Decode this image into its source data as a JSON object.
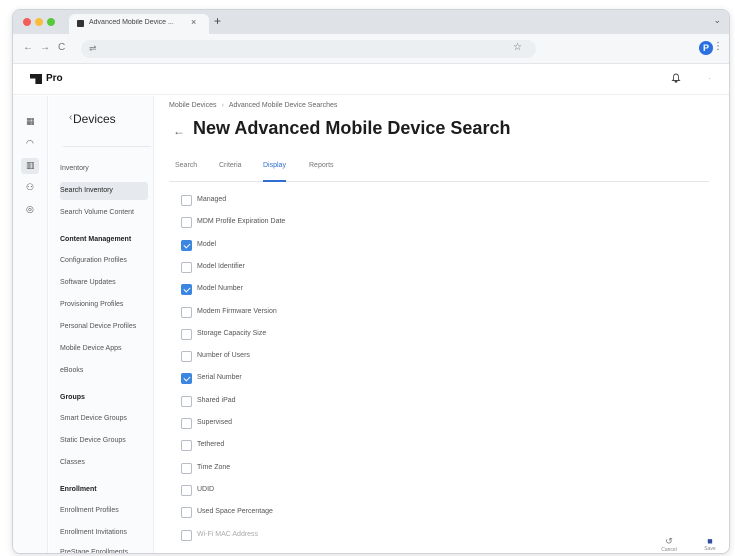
{
  "browser": {
    "tab_title": "Advanced Mobile Device ...",
    "tab_close": "×",
    "new_tab": "+",
    "tab_menu": "⌄",
    "back": "←",
    "forward": "→",
    "reload": "C",
    "site_settings_icon": "⇌",
    "bookmark_star": "☆",
    "extension_label": "P",
    "menu": "⋮"
  },
  "app": {
    "product": "Pro",
    "bell": "🔔",
    "more": "·"
  },
  "rail": {
    "icons": [
      "computer-icon",
      "apple-icon",
      "devices-icon",
      "users-icon",
      "settings-icon"
    ],
    "glyphs": [
      "▦",
      "◠",
      "▥",
      "⚇",
      "◎"
    ]
  },
  "sidebar": {
    "back_icon": "‹",
    "title": "Devices",
    "items_top": [
      {
        "label": "Inventory",
        "selected": false
      },
      {
        "label": "Search Inventory",
        "selected": true
      },
      {
        "label": "Search Volume Content",
        "selected": false
      }
    ],
    "content_management_heading": "Content Management",
    "content_items": [
      "Configuration Profiles",
      "Software Updates",
      "Provisioning Profiles",
      "Personal Device Profiles",
      "Mobile Device Apps",
      "eBooks"
    ],
    "groups_heading": "Groups",
    "group_items": [
      "Smart Device Groups",
      "Static Device Groups",
      "Classes"
    ],
    "enrollment_heading": "Enrollment",
    "enrollment_items": [
      "Enrollment Profiles",
      "Enrollment Invitations",
      "PreStage Enrollments"
    ]
  },
  "main": {
    "breadcrumb": [
      "Mobile Devices",
      "Advanced Mobile Device Searches"
    ],
    "back_arrow": "←",
    "title": "New Advanced Mobile Device Search",
    "tabs": [
      {
        "label": "Search",
        "active": false
      },
      {
        "label": "Criteria",
        "active": false
      },
      {
        "label": "Display",
        "active": true
      },
      {
        "label": "Reports",
        "active": false
      }
    ],
    "criteria": [
      {
        "label": "Managed",
        "checked": false
      },
      {
        "label": "MDM Profile Expiration Date",
        "checked": false
      },
      {
        "label": "Model",
        "checked": true
      },
      {
        "label": "Model Identifier",
        "checked": false
      },
      {
        "label": "Model Number",
        "checked": true
      },
      {
        "label": "Modem Firmware Version",
        "checked": false
      },
      {
        "label": "Storage Capacity Size",
        "checked": false
      },
      {
        "label": "Number of Users",
        "checked": false
      },
      {
        "label": "Serial Number",
        "checked": true
      },
      {
        "label": "Shared iPad",
        "checked": false
      },
      {
        "label": "Supervised",
        "checked": false
      },
      {
        "label": "Tethered",
        "checked": false
      },
      {
        "label": "Time Zone",
        "checked": false
      },
      {
        "label": "UDID",
        "checked": false
      },
      {
        "label": "Used Space Percentage",
        "checked": false
      },
      {
        "label": "Wi-Fi MAC Address",
        "checked": false
      }
    ],
    "actions": [
      {
        "icon": "cancel-icon",
        "glyph": "↺",
        "label": "Cancel"
      },
      {
        "icon": "save-icon",
        "glyph": "■",
        "label": "Save"
      }
    ]
  },
  "colors": {
    "accent": "#2f6fcf",
    "checkbox_checked": "#3b86e0",
    "sidebar_bg": "#fafbfc",
    "browser_chrome": "#dfe3e8"
  }
}
